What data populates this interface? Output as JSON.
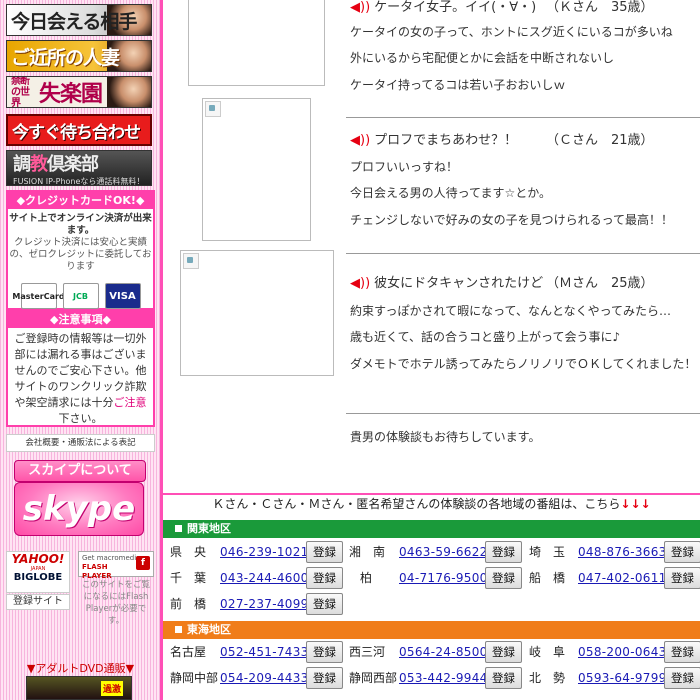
{
  "sidebar": {
    "banners": [
      {
        "label": "今日会える相手"
      },
      {
        "label": "ご近所の人妻"
      },
      {
        "label_small": "禁断の世界",
        "label": "失楽園"
      },
      {
        "label": "今すぐ待ち合わせ"
      },
      {
        "label_a": "調",
        "label_b": "教",
        "label_c": "倶楽部",
        "sub": "FUSION IP-Phoneなら通話料無料！"
      }
    ],
    "credit": {
      "heading": "◆クレジットカードOK!◆",
      "lead": "サイト上でオンライン決済が出来ます。",
      "body": "クレジット決済には安心と実績の、ゼロクレジットに委託しております",
      "cards": [
        "MasterCard",
        "JCB",
        "VISA"
      ]
    },
    "notice": {
      "heading": "◆注意事項◆",
      "body_1": "ご登録時の情報等は一切外部には漏れる事はございませんのでご安心下さい。他サイトのワンクリック詐欺や架空請求には十分",
      "body_red": "ご注意",
      "body_2": "下さい。"
    },
    "company_link": "会社概要・通販法による表記",
    "skype": {
      "heading": "スカイプについて",
      "logo": "skype"
    },
    "yahoo": "YAHOO!",
    "yahoo_sub": "JAPAN",
    "biglobe": "BIGLOBE",
    "register_site": "登録サイト",
    "flash": {
      "line1": "Get macromedia",
      "line2": "FLASH",
      "line3": "PLAYER"
    },
    "flash_note": "このサイトをご覧になるにはFlash Playerが必要です。",
    "dvd_link": "▼アダルトDVD通販▼",
    "dvd_tag": "過激"
  },
  "experiences": [
    {
      "title": "ケータイ女子。イイ(・∀・)",
      "who": "（Ｋさん　35歳）",
      "lines": [
        "ケータイの女の子って、ホントにスグ近くにいるコが多いね",
        "外にいるから宅配便とかに会話を中断されないし",
        "ケータイ持ってるコは若い子おおいしｗ"
      ]
    },
    {
      "title": "プロフでまちあわせ？！",
      "who": "（Ｃさん　21歳）",
      "lines": [
        "プロフいいっすね！",
        "今日会える男の人待ってます☆とか。",
        "チェンジしないで好みの女の子を見つけられるって最高！！"
      ]
    },
    {
      "title": "彼女にドタキャンされたけど",
      "who": "（Ｍさん　25歳）",
      "lines": [
        "約束すっぽかされて暇になって、なんとなくやってみたら…",
        "歳も近くて、話の合うコと盛り上がって会う事に♪",
        "ダメモトでホテル誘ってみたらノリノリでＯＫしてくれました！"
      ]
    }
  ],
  "closing": "貴男の体験談もお待ちしています。",
  "headline": {
    "text": "Ｋさん・Ｃさん・Ｍさん・匿名希望さんの体験談の各地域の番組は、こちら",
    "arrows": "↓↓↓"
  },
  "register_label": "登録",
  "regions": [
    {
      "name": "関東地区",
      "color": "#1a9a3a",
      "rows": [
        [
          {
            "area": "県　央",
            "phone": "046-239-1021"
          },
          {
            "area": "湘　南",
            "phone": "0463-59-6622"
          },
          {
            "area": "埼　玉",
            "phone": "048-876-3663"
          }
        ],
        [
          {
            "area": "千　葉",
            "phone": "043-244-4600"
          },
          {
            "area": "柏",
            "phone": "04-7176-9500"
          },
          {
            "area": "船　橋",
            "phone": "047-402-0611"
          }
        ],
        [
          {
            "area": "前　橋",
            "phone": "027-237-4099"
          }
        ]
      ]
    },
    {
      "name": "東海地区",
      "color": "#f07d1a",
      "rows": [
        [
          {
            "area": "名古屋",
            "phone": "052-451-7433"
          },
          {
            "area": "西三河",
            "phone": "0564-24-8500"
          },
          {
            "area": "岐　阜",
            "phone": "058-200-0643"
          }
        ],
        [
          {
            "area": "静岡中部",
            "phone": "054-209-4433"
          },
          {
            "area": "静岡西部",
            "phone": "053-442-9944"
          },
          {
            "area": "北　勢",
            "phone": "0593-64-9799"
          }
        ]
      ]
    }
  ]
}
